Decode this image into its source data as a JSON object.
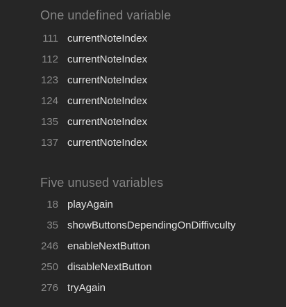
{
  "undefined_section": {
    "title": "One undefined variable",
    "items": [
      {
        "line": "111",
        "name": "currentNoteIndex"
      },
      {
        "line": "112",
        "name": "currentNoteIndex"
      },
      {
        "line": "123",
        "name": "currentNoteIndex"
      },
      {
        "line": "124",
        "name": "currentNoteIndex"
      },
      {
        "line": "135",
        "name": "currentNoteIndex"
      },
      {
        "line": "137",
        "name": "currentNoteIndex"
      }
    ]
  },
  "unused_section": {
    "title": "Five unused variables",
    "items": [
      {
        "line": "18",
        "name": "playAgain"
      },
      {
        "line": "35",
        "name": "showButtonsDependingOnDiffivculty"
      },
      {
        "line": "246",
        "name": "enableNextButton"
      },
      {
        "line": "250",
        "name": "disableNextButton"
      },
      {
        "line": "276",
        "name": "tryAgain"
      }
    ]
  },
  "colors": {
    "background": "#262626",
    "title": "#858585",
    "line_number": "#8a8a8a",
    "variable": "#e2e2e2"
  }
}
